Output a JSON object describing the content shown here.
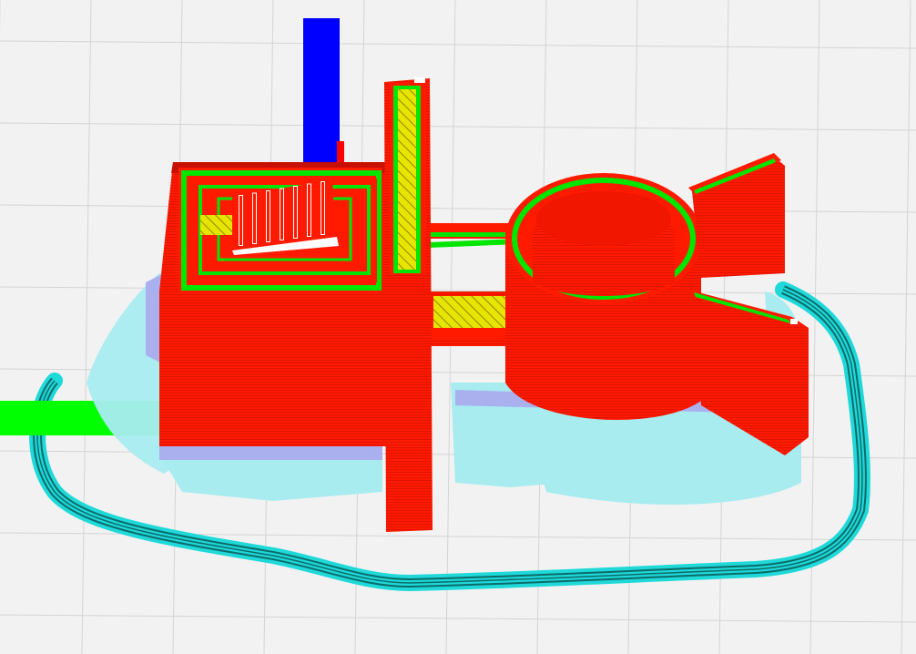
{
  "viewport": {
    "view_mode": "layer-view",
    "background_color": "#f2f2f2",
    "grid_color": "#d4d4d4"
  },
  "axes": {
    "x_color": "#00ff00",
    "z_color": "#0000ff",
    "y_color": "#ff0000"
  },
  "layer_colors": {
    "wall_outer": "#ff1a00",
    "wall_outer_dark": "#c81000",
    "wall_inner": "#00e600",
    "infill": "#e5e500",
    "skirt": "#1fd8d8",
    "support": "#a8ecf0",
    "support_interface": "#aab0ee"
  }
}
